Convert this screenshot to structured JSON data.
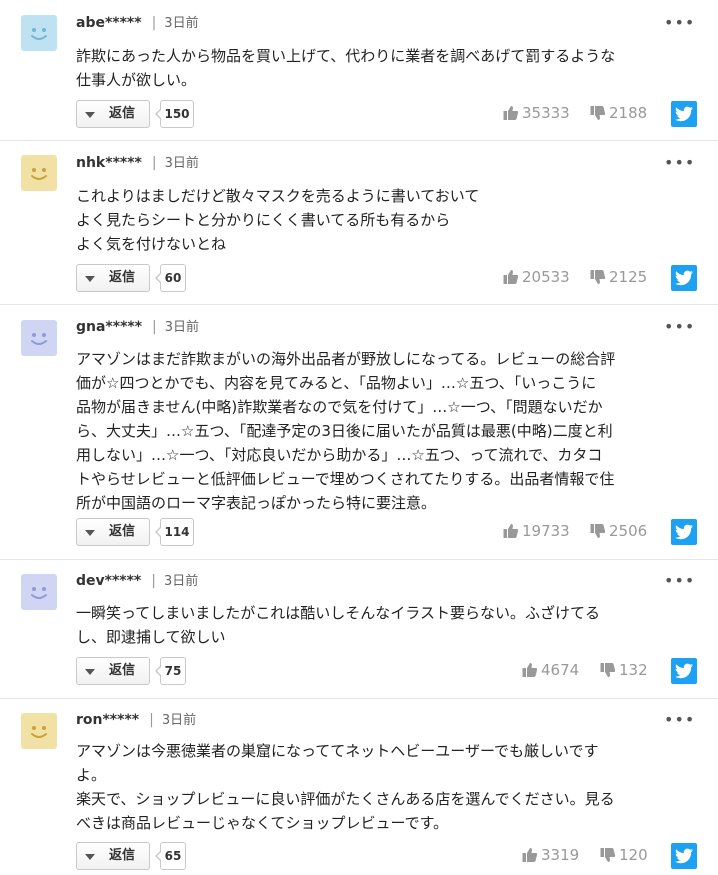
{
  "icons": {
    "avatar": "smiley-face-icon",
    "more": "ellipsis-icon",
    "reply_caret": "caret-down-icon",
    "like": "thumbs-up-icon",
    "dislike": "thumbs-down-icon",
    "share": "twitter-icon"
  },
  "colors": {
    "twitter": "#1da1f2",
    "avatar_blue": "#bfe2f3",
    "avatar_lavender": "#cfd5f2",
    "avatar_yellow": "#f2e1a4",
    "vote_text": "#999999"
  },
  "more_label": "•••",
  "separator": "|",
  "comments": [
    {
      "user": "abe*****",
      "date": "3日前",
      "text": "詐欺にあった人から物品を買い上げて、代わりに業者を調べあげて罰するような\n仕事人が欲しい。",
      "reply_label": "返信",
      "replies": "150",
      "likes": "35333",
      "dislikes": "2188"
    },
    {
      "user": "nhk*****",
      "date": "3日前",
      "text": "これよりはましだけど散々マスクを売るように書いておいて\nよく見たらシートと分かりにくく書いてる所も有るから\nよく気を付けないとね",
      "reply_label": "返信",
      "replies": "60",
      "likes": "20533",
      "dislikes": "2125"
    },
    {
      "user": "gna*****",
      "date": "3日前",
      "text": "アマゾンはまだ詐欺まがいの海外出品者が野放しになってる。レビューの総合評\n価が☆四つとかでも、内容を見てみると、「品物よい」…☆五つ、「いっこうに\n品物が届きません(中略)詐欺業者なので気を付けて」…☆一つ、「問題ないだか\nら、大丈夫」…☆五つ、「配達予定の3日後に届いたが品質は最悪(中略)二度と利\n用しない」…☆一つ、「対応良いだから助かる」…☆五つ、って流れで、カタコ\nトやらせレビューと低評価レビューで埋めつくされてたりする。出品者情報で住\n所が中国語のローマ字表記っぽかったら特に要注意。",
      "reply_label": "返信",
      "replies": "114",
      "likes": "19733",
      "dislikes": "2506"
    },
    {
      "user": "dev*****",
      "date": "3日前",
      "text": "一瞬笑ってしまいましたがこれは酷いしそんなイラスト要らない。ふざけてる\nし、即逮捕して欲しい",
      "reply_label": "返信",
      "replies": "75",
      "likes": "4674",
      "dislikes": "132"
    },
    {
      "user": "ron*****",
      "date": "3日前",
      "text": "アマゾンは今悪徳業者の巣窟になっててネットヘビーユーザーでも厳しいです\nよ。\n楽天で、ショップレビューに良い評価がたくさんある店を選んでください。見る\nべきは商品レビューじゃなくてショップレビューです。",
      "reply_label": "返信",
      "replies": "65",
      "likes": "3319",
      "dislikes": "120"
    }
  ]
}
